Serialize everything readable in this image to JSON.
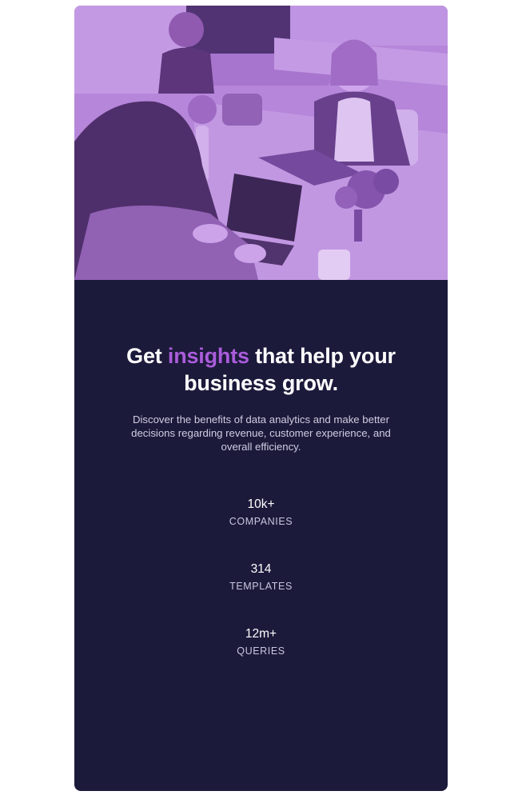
{
  "hero": {
    "image_alt": "people working at a table with laptops",
    "overlay_color": "#aa5cdb"
  },
  "headline": {
    "before": "Get ",
    "accent": "insights",
    "after": " that help your business grow."
  },
  "description": "Discover the benefits of data analytics and make better decisions regarding revenue, customer experience, and overall efficiency.",
  "stats": [
    {
      "value": "10k+",
      "label": "COMPANIES"
    },
    {
      "value": "314",
      "label": "TEMPLATES"
    },
    {
      "value": "12m+",
      "label": "QUERIES"
    }
  ],
  "colors": {
    "card_background": "#1c1a3b",
    "accent": "#aa5cdb",
    "text_primary": "#ffffff",
    "text_secondary": "#cfcde0"
  }
}
